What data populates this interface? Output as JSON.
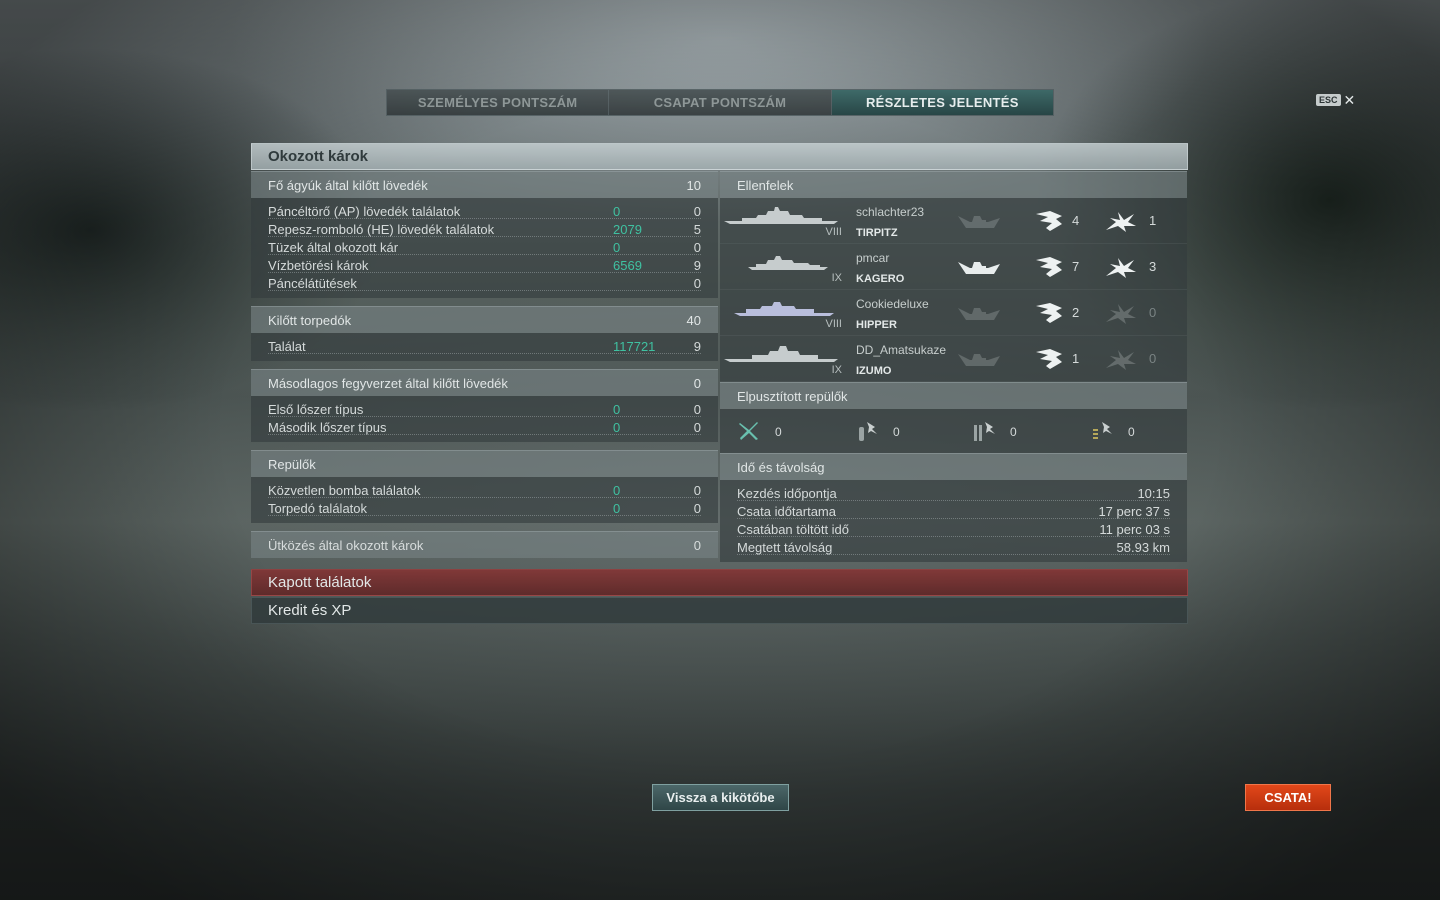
{
  "tabs": [
    {
      "label": "SZEMÉLYES PONTSZÁM"
    },
    {
      "label": "CSAPAT PONTSZÁM"
    },
    {
      "label": "RÉSZLETES JELENTÉS"
    }
  ],
  "close": {
    "key_label": "ESC",
    "icon": "close-icon"
  },
  "damage": {
    "title": "Okozott károk",
    "main_guns": {
      "title": "Fő ágyúk által kilőtt lövedék",
      "value": "10",
      "rows": [
        {
          "label": "Páncéltörő (AP) lövedék találatok",
          "damage": "0",
          "count": "0"
        },
        {
          "label": "Repesz-romboló (HE) lövedék találatok",
          "damage": "2079",
          "count": "5"
        },
        {
          "label": "Tüzek által okozott kár",
          "damage": "0",
          "count": "0"
        },
        {
          "label": "Vízbetörési károk",
          "damage": "6569",
          "count": "9"
        },
        {
          "label": "Páncélátütések",
          "damage": "",
          "count": "0"
        }
      ]
    },
    "torpedoes": {
      "title": "Kilőtt torpedók",
      "value": "40",
      "rows": [
        {
          "label": "Találat",
          "damage": "117721",
          "count": "9"
        }
      ]
    },
    "secondary": {
      "title": "Másodlagos fegyverzet által kilőtt lövedék",
      "value": "0",
      "rows": [
        {
          "label": "Első lőszer típus",
          "damage": "0",
          "count": "0"
        },
        {
          "label": "Második lőszer típus",
          "damage": "0",
          "count": "0"
        }
      ]
    },
    "aircraft": {
      "title": "Repülők",
      "rows": [
        {
          "label": "Közvetlen bomba találatok",
          "damage": "0",
          "count": "0"
        },
        {
          "label": "Torpedó találatok",
          "damage": "0",
          "count": "0"
        }
      ]
    },
    "ramming": {
      "title": "Ütközés által okozott károk",
      "value": "0"
    }
  },
  "enemies": {
    "title": "Ellenfelek",
    "list": [
      {
        "player": "schlachter23",
        "ship": "TIRPITZ",
        "tier": "VIII",
        "spotted": "4",
        "hits": "1",
        "sunk": false,
        "hits_active": true
      },
      {
        "player": "pmcar",
        "ship": "KAGERO",
        "tier": "IX",
        "spotted": "7",
        "hits": "3",
        "sunk": true,
        "hits_active": true
      },
      {
        "player": "Cookiedeluxe",
        "ship": "HIPPER",
        "tier": "VIII",
        "spotted": "2",
        "hits": "0",
        "sunk": false,
        "hits_active": false
      },
      {
        "player": "DD_Amatsukaze",
        "ship": "IZUMO",
        "tier": "IX",
        "spotted": "1",
        "hits": "0",
        "sunk": false,
        "hits_active": false
      }
    ]
  },
  "planes_destroyed": {
    "title": "Elpusztított repülők",
    "items": [
      {
        "icon": "fighter-plane-icon",
        "value": "0"
      },
      {
        "icon": "torpedo-bomber-icon",
        "value": "0"
      },
      {
        "icon": "dive-bomber-icon",
        "value": "0"
      },
      {
        "icon": "spotter-plane-icon",
        "value": "0"
      }
    ]
  },
  "time_distance": {
    "title": "Idő és távolság",
    "rows": [
      {
        "label": "Kezdés időpontja",
        "value": "10:15"
      },
      {
        "label": "Csata időtartama",
        "value": "17 perc 37 s"
      },
      {
        "label": "Csatában töltött idő",
        "value": "11 perc 03 s"
      },
      {
        "label": "Megtett távolság",
        "value": "58.93 km"
      }
    ]
  },
  "received": {
    "title": "Kapott találatok"
  },
  "credits": {
    "title": "Kredit és XP"
  },
  "buttons": {
    "port": "Vissza a kikötőbe",
    "battle": "CSATA!"
  },
  "colors": {
    "accent_green": "#3fc1a1",
    "battle_orange": "#d63c12",
    "received_red": "#843434"
  }
}
